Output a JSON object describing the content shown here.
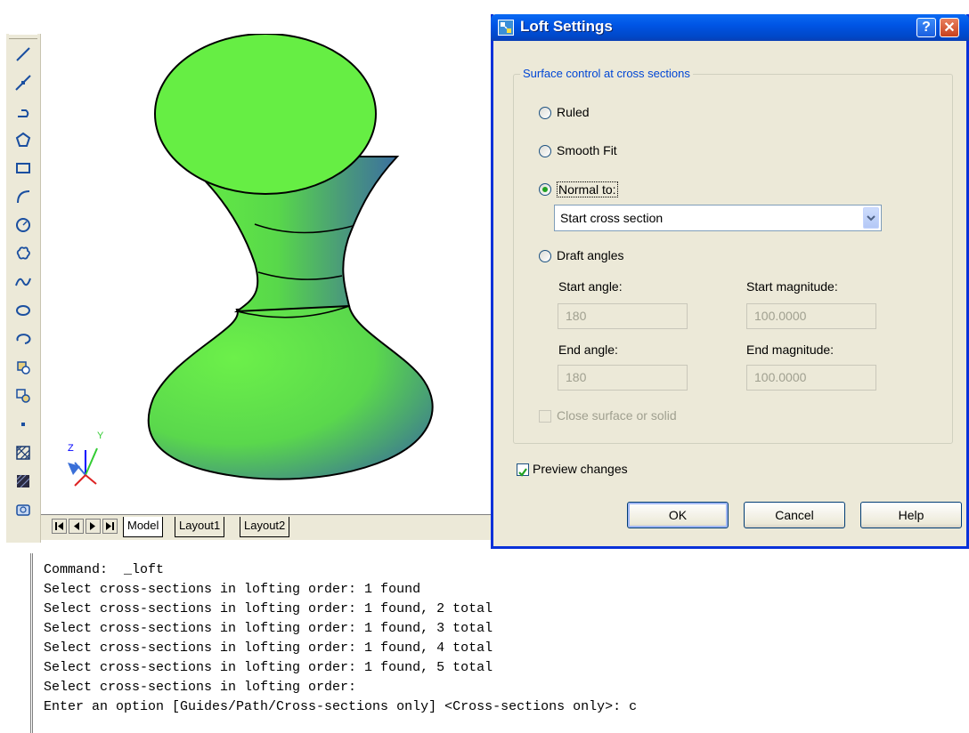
{
  "toolbar": {
    "tools": [
      "line-icon",
      "construction-line-icon",
      "polyline-icon",
      "polygon-icon",
      "rectangle-icon",
      "arc-icon",
      "circle-icon",
      "revision-cloud-icon",
      "spline-icon",
      "ellipse-icon",
      "ellipse-arc-icon",
      "insert-block-icon",
      "make-block-icon",
      "point-icon",
      "hatch-icon",
      "gradient-icon",
      "region-icon"
    ]
  },
  "viewport": {
    "ucs_axes": [
      "Z",
      "Y"
    ]
  },
  "tabs": {
    "items": [
      "Model",
      "Layout1",
      "Layout2"
    ],
    "active": "Model"
  },
  "dialog": {
    "title": "Loft Settings",
    "help_glyph": "?",
    "close_glyph": "✕",
    "group_label": "Surface control at cross sections",
    "ruled_label": "Ruled",
    "smooth_label": "Smooth Fit",
    "normal_label": "Normal to:",
    "normal_select_value": "Start cross section",
    "draft_label": "Draft angles",
    "start_angle_label": "Start angle:",
    "start_angle_value": "180",
    "start_magnitude_label": "Start magnitude:",
    "start_magnitude_value": "100.0000",
    "end_angle_label": "End angle:",
    "end_angle_value": "180",
    "end_magnitude_label": "End magnitude:",
    "end_magnitude_value": "100.0000",
    "close_surface_label": "Close surface or solid",
    "preview_label": "Preview changes",
    "preview_checked": true,
    "selected_option": "Normal to:",
    "ok_label": "OK",
    "cancel_label": "Cancel",
    "help_label": "Help"
  },
  "command": {
    "lines": [
      "Command:  _loft",
      "Select cross-sections in lofting order: 1 found",
      "Select cross-sections in lofting order: 1 found, 2 total",
      "Select cross-sections in lofting order: 1 found, 3 total",
      "Select cross-sections in lofting order: 1 found, 4 total",
      "Select cross-sections in lofting order: 1 found, 5 total",
      "Select cross-sections in lofting order:",
      "Enter an option [Guides/Path/Cross-sections only] <Cross-sections only>: c"
    ]
  },
  "colors": {
    "loft_green": "#66ee44",
    "loft_blue": "#3b6fa0",
    "dialog_title_blue": "#0055e5",
    "dialog_face": "#ece9d8"
  }
}
